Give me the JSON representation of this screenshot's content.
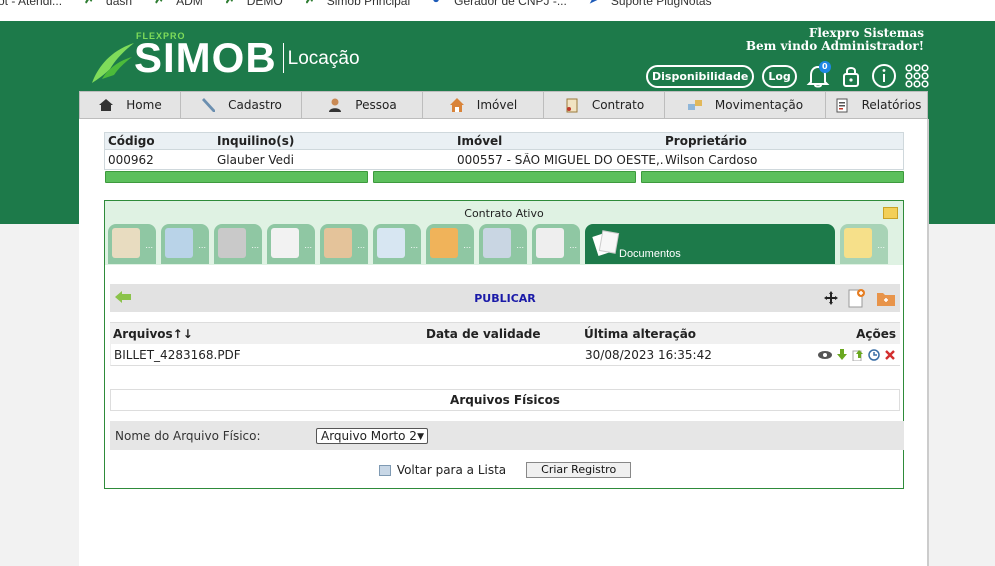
{
  "bookmarks": [
    {
      "label": "ot - Atendi...",
      "icon": "none"
    },
    {
      "label": "dash",
      "icon": "bookmark-x-icon"
    },
    {
      "label": "ADM",
      "icon": "bookmark-x-icon"
    },
    {
      "label": "DEMO",
      "icon": "bookmark-x-icon"
    },
    {
      "label": "Simob Principal",
      "icon": "bookmark-x-icon"
    },
    {
      "label": "Gerador de CNPJ -...",
      "icon": "bookmark-globe-icon"
    },
    {
      "label": "Suporte PlugNotas",
      "icon": "bookmark-arrow-icon"
    }
  ],
  "header": {
    "logo_small": "FLEXPRO",
    "logo_main": "SIMOB",
    "logo_module": "Locação",
    "company": "Flexpro Sistemas",
    "welcome": "Bem vindo Administrador!",
    "disponibilidade_label": "Disponibilidade",
    "log_label": "Log",
    "notification_count": "0"
  },
  "nav": [
    {
      "label": "Home",
      "icon": "home-icon"
    },
    {
      "label": "Cadastro",
      "icon": "pencil-icon"
    },
    {
      "label": "Pessoa",
      "icon": "person-icon"
    },
    {
      "label": "Imóvel",
      "icon": "house-icon"
    },
    {
      "label": "Contrato",
      "icon": "contract-icon"
    },
    {
      "label": "Movimentação",
      "icon": "transfer-icon"
    },
    {
      "label": "Relatórios",
      "icon": "report-icon"
    }
  ],
  "contract_info": {
    "headers": [
      "Código",
      "Inquilino(s)",
      "Imóvel",
      "Proprietário"
    ],
    "row": [
      "000962",
      "Glauber Vedi",
      "000557 - SÃO MIGUEL DO OESTE,...",
      "Wilson Cardoso"
    ]
  },
  "contract_box": {
    "title": "Contrato Ativo",
    "active_tab_label": "Documentos",
    "tab_dots": "...",
    "publish_label": "PUBLICAR"
  },
  "files_table": {
    "headers": [
      "Arquivos↑↓",
      "Data de validade",
      "Última alteração",
      "Ações"
    ],
    "rows": [
      {
        "name": "BILLET_4283168.PDF",
        "validity": "",
        "modified": "30/08/2023 16:35:42"
      }
    ]
  },
  "physical": {
    "title": "Arquivos Físicos",
    "field_label": "Nome do Arquivo Físico:",
    "selected": "Arquivo Morto 2"
  },
  "footer": {
    "back_label": "Voltar para a Lista",
    "create_label": "Criar Registro"
  },
  "colors": {
    "header_green": "#1d7a4a",
    "tab_green": "#8fc7a3",
    "progress_green": "#5cbf5c",
    "publish_blue": "#1a1aa8"
  }
}
